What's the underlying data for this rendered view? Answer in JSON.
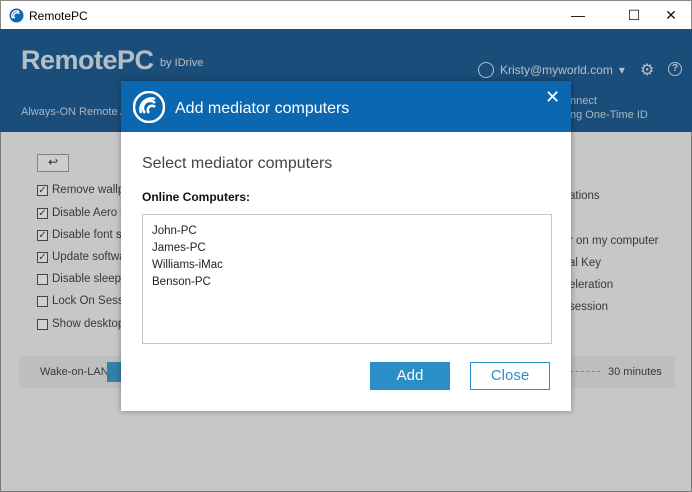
{
  "window": {
    "title": "RemotePC",
    "minimize": "—",
    "maximize": "☐",
    "close": "✕"
  },
  "header": {
    "brand": "RemotePC",
    "brand_by": "by IDrive",
    "user_email": "Kristy@myworld.com",
    "user_caret": "▾",
    "nav_left": "Always-ON Remote Ac",
    "nav_right_1": "nnect",
    "nav_right_2": "ng One-Time ID",
    "help": "?"
  },
  "background": {
    "back_label": "↩",
    "options": [
      {
        "label": "Remove wallpa",
        "checked": true
      },
      {
        "label": "Disable Aero th",
        "checked": true
      },
      {
        "label": "Disable font sn",
        "checked": true
      },
      {
        "label": "Update softwa",
        "checked": true
      },
      {
        "label": "Disable sleep n",
        "checked": false
      },
      {
        "label": "Lock On Sessio",
        "checked": false
      },
      {
        "label": "Show desktop",
        "checked": false
      }
    ],
    "right_options": [
      "ations",
      "r on my computer",
      "al Key",
      "eleration",
      "session"
    ],
    "wake_on_lan": "Wake-on-LAN",
    "minutes": "30 minutes"
  },
  "dialog": {
    "title": "Add mediator computers",
    "close": "✕",
    "subtitle": "Select mediator computers",
    "list_label": "Online Computers:",
    "computers": [
      "John-PC",
      "James-PC",
      "Williams-iMac",
      "Benson-PC"
    ],
    "add_label": "Add",
    "close_label": "Close"
  },
  "colors": {
    "header_bg": "#0c4f8b",
    "dialog_header_bg": "#0c67b1",
    "accent": "#2b8fc7"
  }
}
